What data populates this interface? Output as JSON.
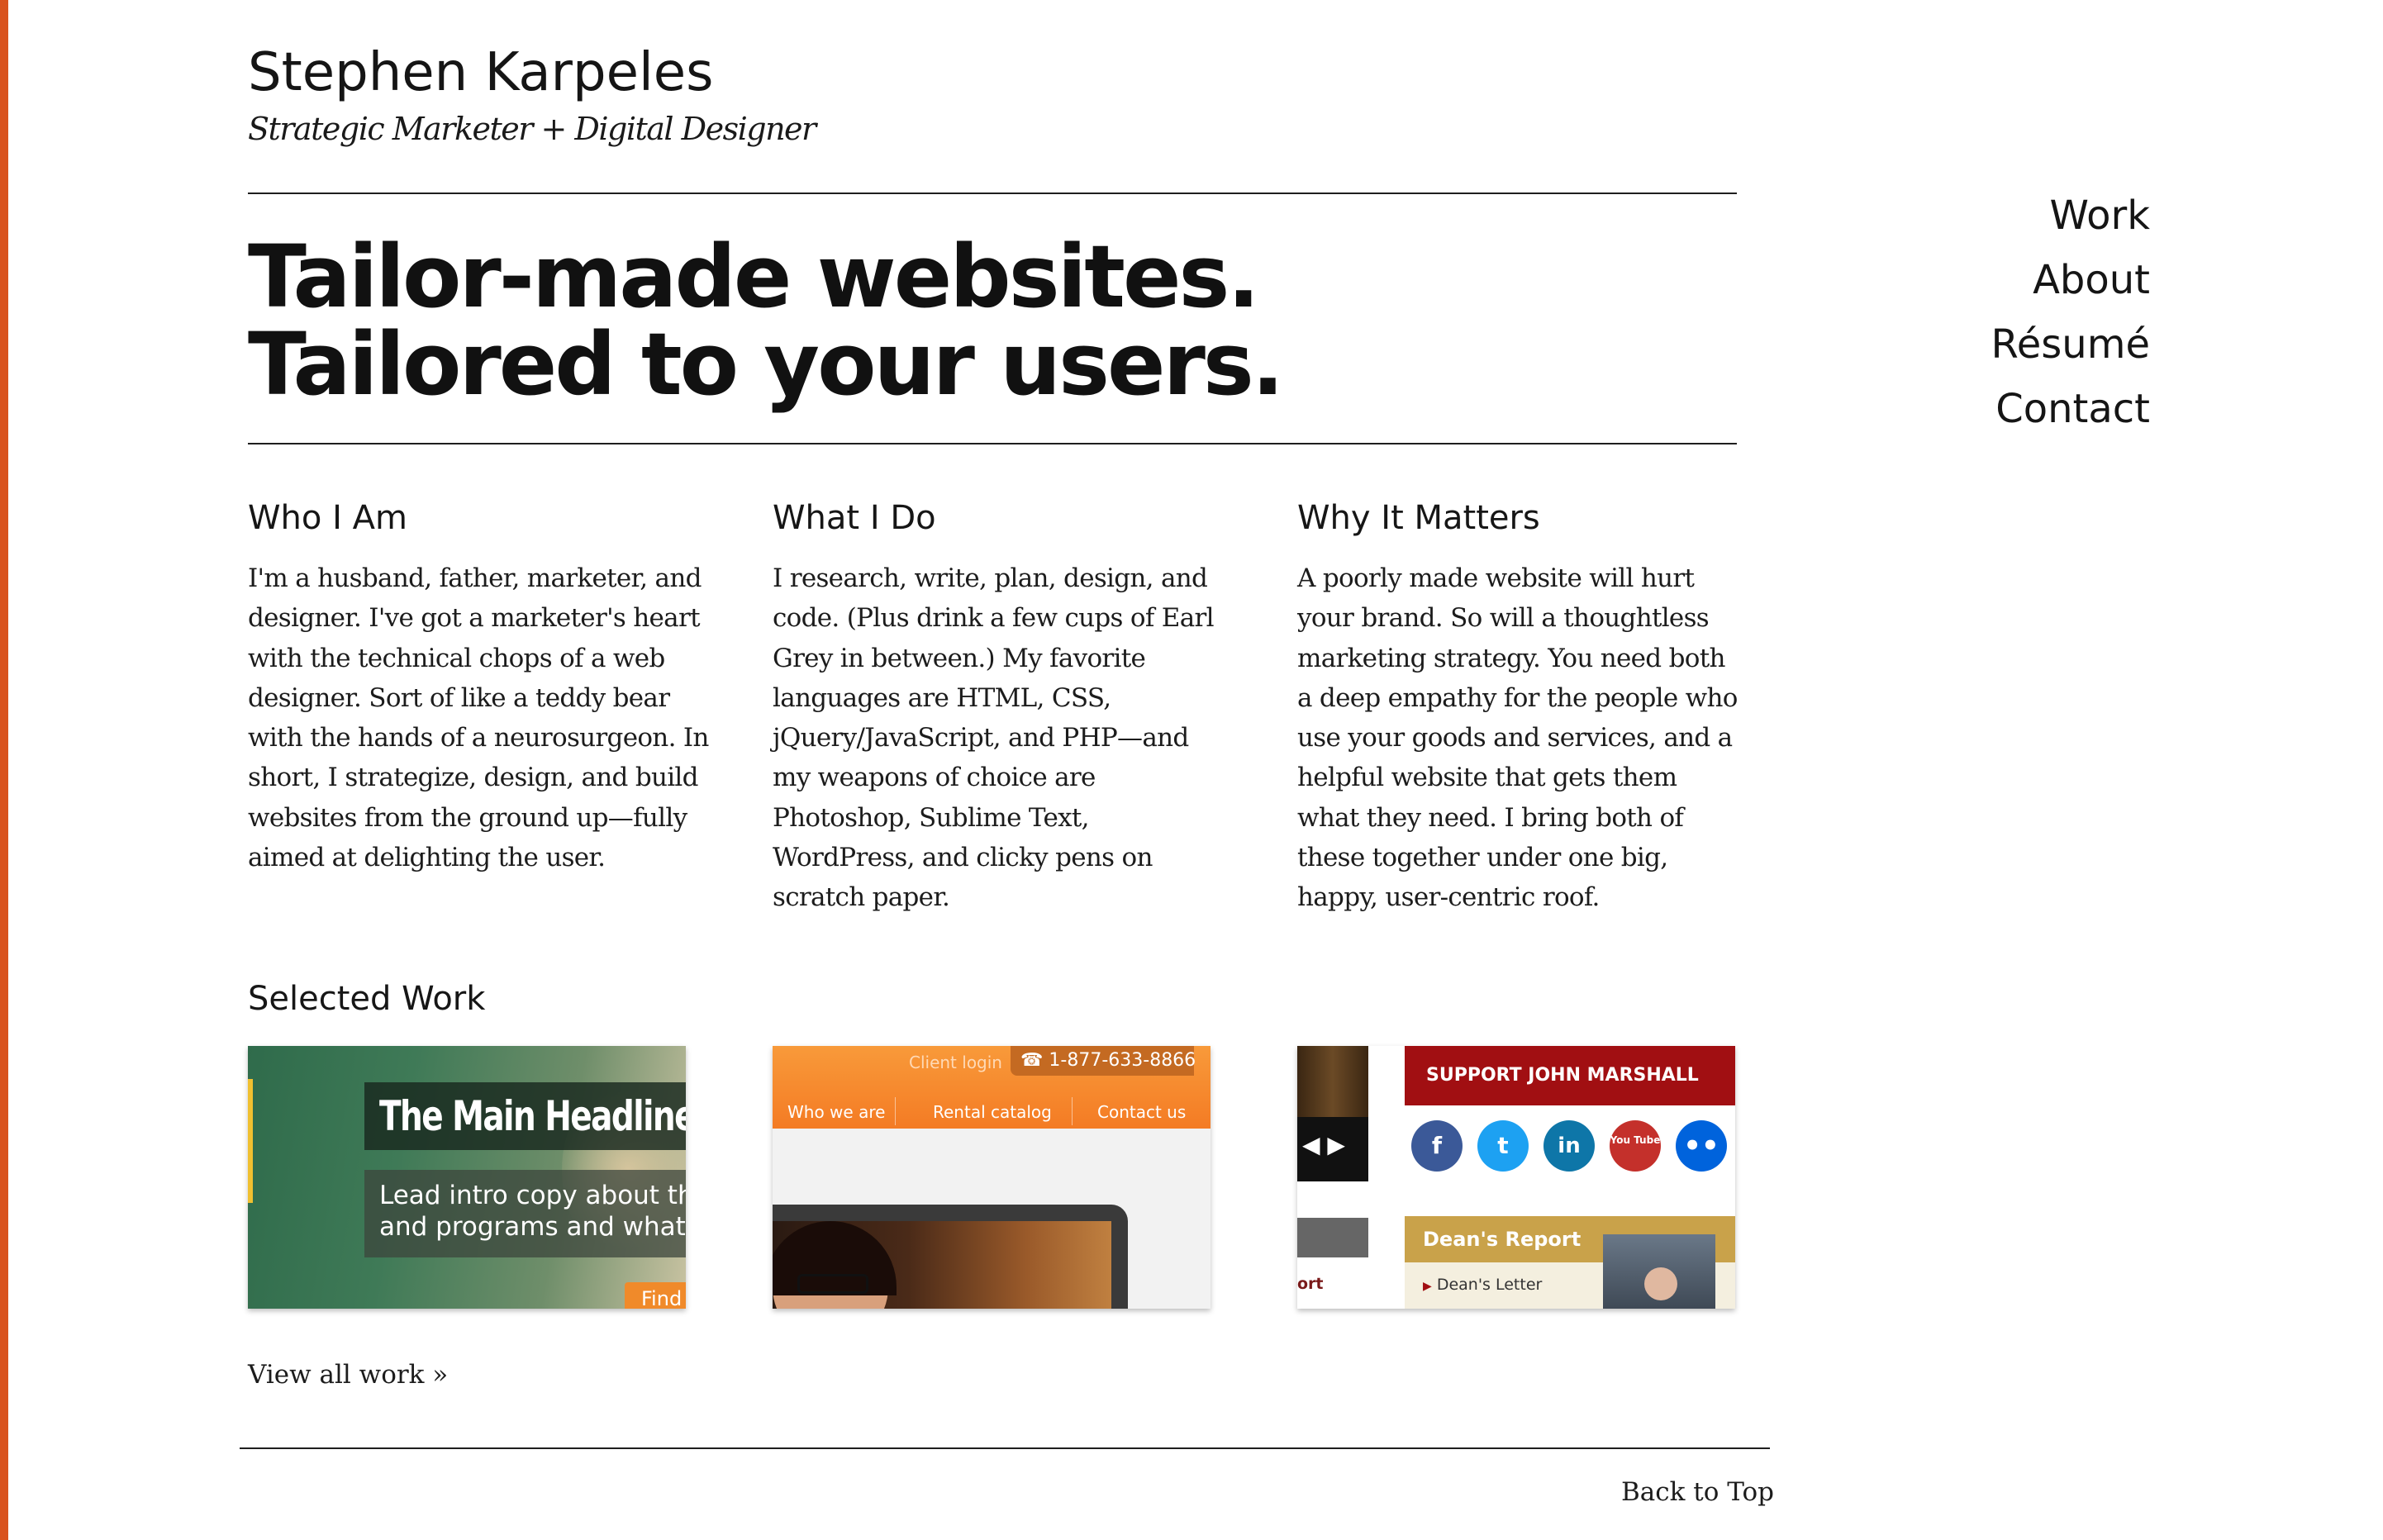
{
  "site": {
    "name": "Stephen Karpeles",
    "tagline": "Strategic Marketer + Digital Designer"
  },
  "hero": {
    "line1": "Tailor-made websites.",
    "line2": "Tailored to your users."
  },
  "columns": [
    {
      "heading": "Who I Am",
      "body": "I'm a husband, father, marketer, and designer. I've got a marketer's heart with the technical chops of a web designer. Sort of like a teddy bear with the hands of a neurosurgeon. In short, I strategize, design, and build websites from the ground up—fully aimed at delighting the user."
    },
    {
      "heading": "What I Do",
      "body": "I research, write, plan, design, and code. (Plus drink a few cups of Earl Grey in between.) My favorite languages are HTML, CSS, jQuery/JavaScript, and PHP—and my weapons of choice are Photoshop, Sublime Text, WordPress, and clicky pens on scratch paper."
    },
    {
      "heading": "Why It Matters",
      "body": "A poorly made website will hurt your brand. So will a thoughtless marketing strategy. You need both a deep empathy for the people who use your goods and services, and a helpful website that gets them what they need. I bring both of these together under one big, happy, user-centric roof."
    }
  ],
  "selected_work": {
    "title": "Selected Work",
    "thumb1": {
      "headline": "The Main Headline o",
      "lead_line1": "Lead intro copy about th",
      "lead_line2": "and programs and what",
      "button": "Find"
    },
    "thumb2": {
      "client_login": "Client login",
      "phone": "☎ 1-877-633-8866",
      "nav": [
        "Who we are",
        "Rental catalog",
        "Contact us"
      ]
    },
    "thumb3": {
      "support": "SUPPORT JOHN MARSHALL",
      "arrows": "◀ ▶",
      "social": [
        "f",
        "t",
        "in",
        "You Tube",
        "••"
      ],
      "social_colors": [
        "#3b5998",
        "#1da1f2",
        "#0e76a8",
        "#c4302b",
        "#0063dc"
      ],
      "deans_report": "Dean's Report",
      "deans_letter": "Dean's Letter",
      "side_text": "ort"
    },
    "view_all": "View all work »"
  },
  "footer": {
    "back_to_top": "Back to Top"
  },
  "nav": {
    "items": [
      "Work",
      "About",
      "Résumé",
      "Contact"
    ]
  },
  "colors": {
    "accent": "#d9531e"
  }
}
